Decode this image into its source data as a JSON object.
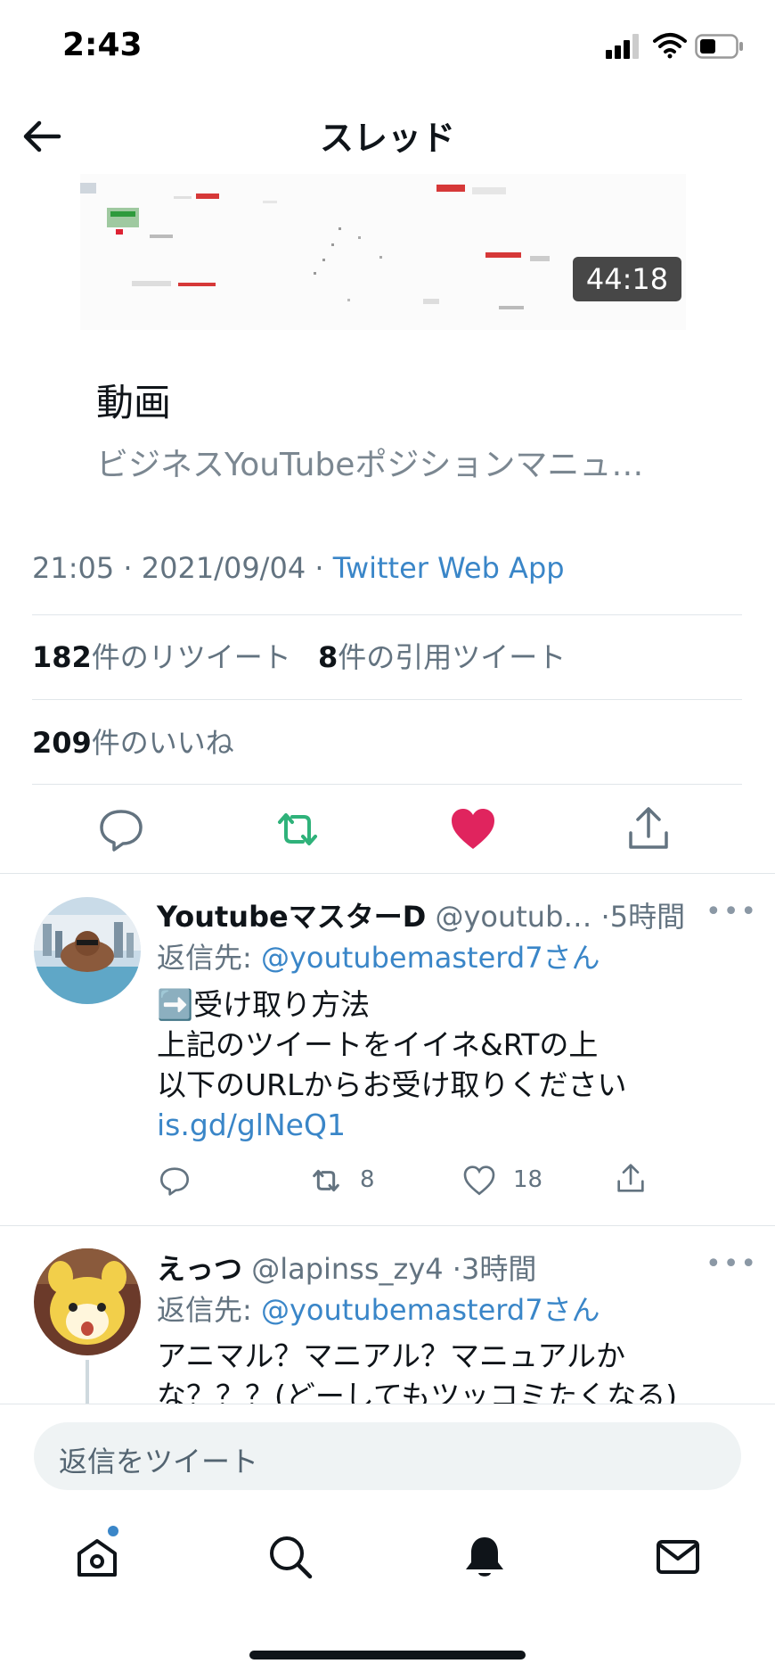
{
  "status": {
    "time": "2:43"
  },
  "header": {
    "title": "スレッド"
  },
  "card": {
    "duration": "44:18",
    "title": "動画",
    "description": "ビジネスYouTubeポジションマニュ…"
  },
  "tweet": {
    "time_date": "21:05 · 2021/09/04 · ",
    "source": "Twitter Web App",
    "retweets_count": "182",
    "retweets_label": "件のリツイート",
    "quotes_count": "8",
    "quotes_label": "件の引用ツイート",
    "likes_count": "209",
    "likes_label": "件のいいね"
  },
  "replies": [
    {
      "name": "YoutubeマスターD",
      "handle": "@youtub…",
      "time": "·5時間",
      "reply_prefix": "返信先: ",
      "reply_to": "@youtubemasterd7さん",
      "lines": [
        "➡️受け取り方法",
        "上記のツイートをイイネ&RTの上",
        "以下のURLからお受け取りください"
      ],
      "link": "is.gd/glNeQ1",
      "retweets": "8",
      "likes": "18"
    },
    {
      "name": "えっつ",
      "handle": "@lapinss_zy4",
      "time": "·3時間",
      "reply_prefix": "返信先: ",
      "reply_to": "@youtubemasterd7さん",
      "lines": [
        "アニマル？マニアル？マニュアルか",
        "な？？？(どーしてもツッコミたくなる)"
      ]
    }
  ],
  "reply_bar": {
    "placeholder": "返信をツイート"
  },
  "colors": {
    "accent": "#3a86c8",
    "retweet_green": "#2fb27a",
    "like_red": "#e0245e"
  },
  "icons": [
    "back-arrow-icon",
    "reply-icon",
    "retweet-icon",
    "heart-icon",
    "share-icon",
    "more-icon",
    "home-icon",
    "search-icon",
    "bell-icon",
    "mail-icon"
  ]
}
